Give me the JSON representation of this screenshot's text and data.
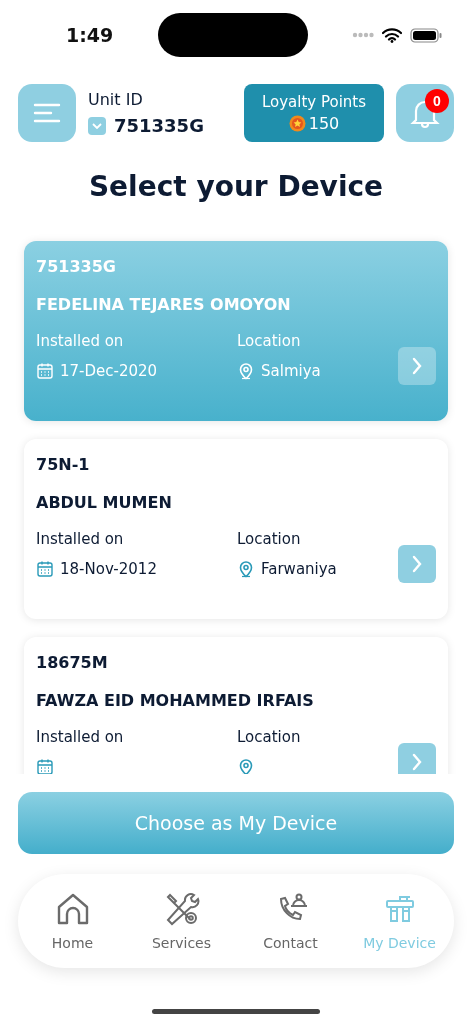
{
  "status_bar": {
    "time": "1:49"
  },
  "header": {
    "unit_label": "Unit ID",
    "unit_id": "751335G",
    "loyalty": {
      "title": "Loyalty Points",
      "points": "150"
    },
    "notifications": {
      "count": "0"
    }
  },
  "title": "Select your Device",
  "devices": [
    {
      "id": "751335G",
      "name": "FEDELINA TEJARES OMOYON",
      "installed_label": "Installed on",
      "date": "17-Dec-2020",
      "location_label": "Location",
      "location": "Salmiya",
      "selected": true
    },
    {
      "id": "75N-1",
      "name": "ABDUL MUMEN",
      "installed_label": "Installed on",
      "date": "18-Nov-2012",
      "location_label": "Location",
      "location": "Farwaniya",
      "selected": false
    },
    {
      "id": "18675M",
      "name": "FAWZA EID MOHAMMED IRFAIS",
      "installed_label": "Installed on",
      "location_label": "Location",
      "selected": false
    }
  ],
  "primary_button": "Choose as My Device",
  "nav": [
    {
      "label": "Home",
      "kind": "home",
      "selected": false
    },
    {
      "label": "Services",
      "kind": "services",
      "selected": false
    },
    {
      "label": "Contact",
      "kind": "contact",
      "selected": false
    },
    {
      "label": "My Device",
      "kind": "device",
      "selected": true
    }
  ]
}
